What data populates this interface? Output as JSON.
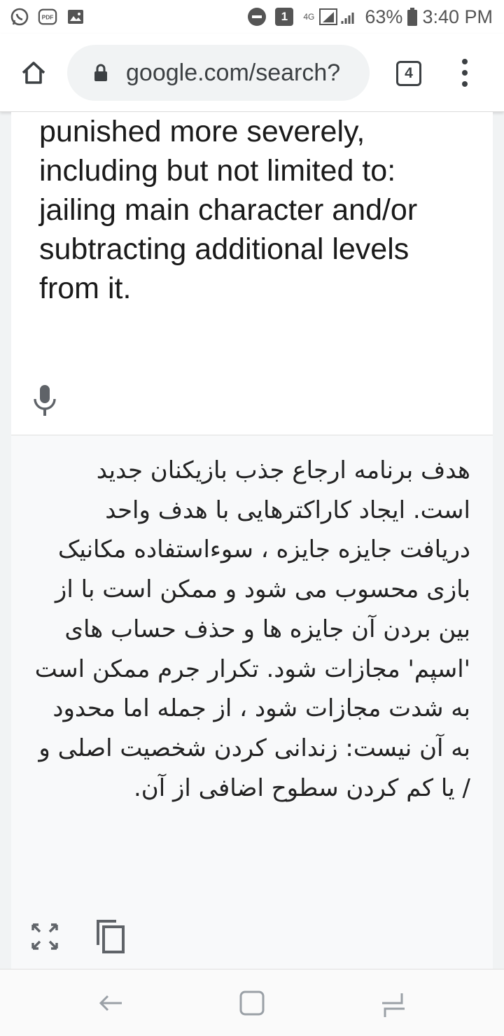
{
  "status_bar": {
    "left_icons": [
      "whatsapp-icon",
      "pdf-icon",
      "gallery-icon"
    ],
    "notification_count": "1",
    "network_label": "4G",
    "battery": "63%",
    "time": "3:40 PM"
  },
  "browser": {
    "url": "google.com/search?",
    "tab_count": "4"
  },
  "translation": {
    "source_text": "punished more severely, including but not limited to: jailing main character and/or subtracting additional levels from it.",
    "target_text": "هدف برنامه ارجاع جذب بازیکنان جدید است. ایجاد کاراکترهایی با هدف واحد دریافت جایزه جایزه ، سوءاستفاده مکانیک بازی محسوب می شود و ممکن است با از بین بردن آن جایزه ها و حذف حساب های 'اسپم' مجازات شود. تکرار جرم ممکن است به شدت مجازات شود ، از جمله اما محدود به آن نیست: زندانی کردن شخصیت اصلی و / یا کم کردن سطوح اضافی از آن."
  },
  "colors": {
    "text_primary": "#1a1a1a",
    "icon_gray": "#5f6368",
    "panel_bg": "#f8f9fa"
  }
}
